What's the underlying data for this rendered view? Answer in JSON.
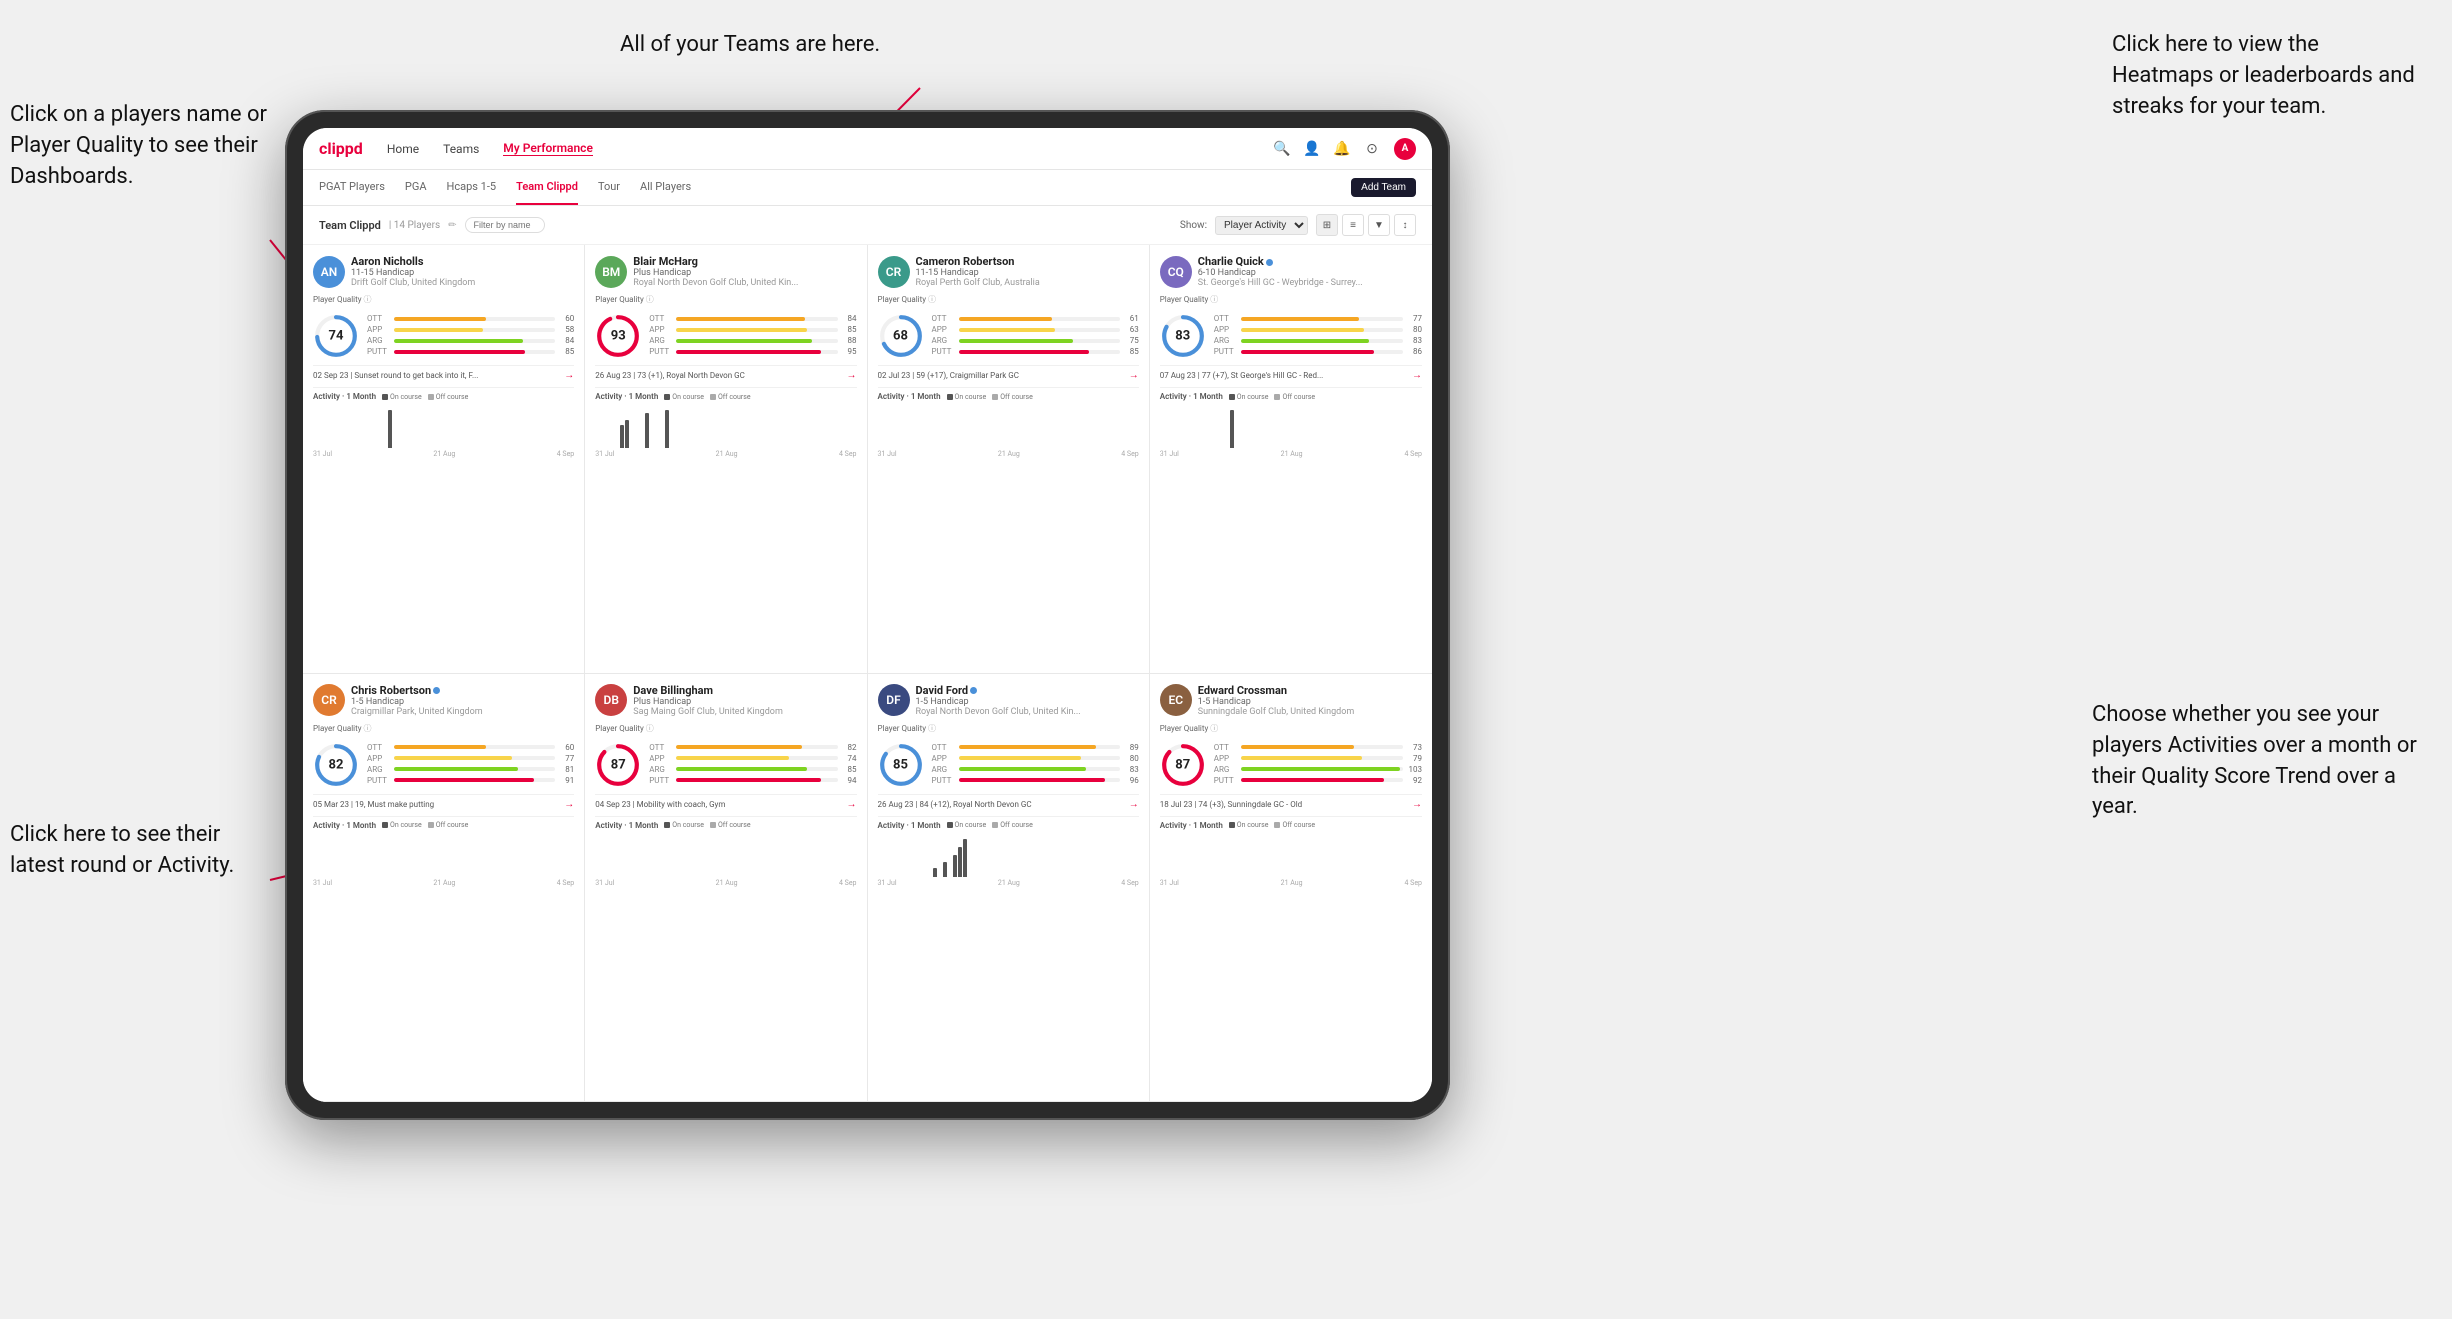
{
  "annotations": {
    "top_left": "Click on a players name\nor Player Quality to see\ntheir Dashboards.",
    "top_center": "All of your Teams are here.",
    "top_right": "Click here to view the\nHeatmaps or leaderboards\nand streaks for your team.",
    "bottom_left": "Click here to see their latest\nround or Activity.",
    "bottom_right": "Choose whether you see\nyour players Activities over\na month or their Quality\nScore Trend over a year."
  },
  "nav": {
    "logo": "clippd",
    "items": [
      "Home",
      "Teams",
      "My Performance"
    ],
    "icons": [
      "search",
      "person",
      "bell",
      "circle-question",
      "avatar"
    ]
  },
  "subnav": {
    "tabs": [
      "PGAT Players",
      "PGA",
      "Hcaps 1-5",
      "Team Clippd",
      "Tour",
      "All Players"
    ],
    "active": "Team Clippd",
    "add_button": "Add Team"
  },
  "team_header": {
    "title": "Team Clippd",
    "count": "14 Players",
    "show_label": "Show:",
    "show_option": "Player Activity",
    "filter_placeholder": "Filter by name"
  },
  "players": [
    {
      "name": "Aaron Nicholls",
      "handicap": "11-15 Handicap",
      "club": "Drift Golf Club, United Kingdom",
      "quality": 74,
      "quality_color": "#4a90d9",
      "stats": [
        {
          "label": "OTT",
          "value": 60,
          "color": "#f5a623"
        },
        {
          "label": "APP",
          "value": 58,
          "color": "#f8d44a"
        },
        {
          "label": "ARG",
          "value": 84,
          "color": "#7ed321"
        },
        {
          "label": "PUTT",
          "value": 85,
          "color": "#e8003d"
        }
      ],
      "latest_round": "02 Sep 23 | Sunset round to get back into it, F...",
      "activity_label": "Activity · 1 Month",
      "chart_bars": [
        0,
        0,
        0,
        0,
        0,
        0,
        0,
        0,
        0,
        0,
        0,
        0,
        0,
        0,
        0,
        14,
        0,
        0,
        0,
        0,
        0,
        0,
        0,
        0,
        0
      ],
      "chart_labels": [
        "31 Jul",
        "21 Aug",
        "4 Sep"
      ],
      "av_color": "av-blue",
      "av_text": "AN"
    },
    {
      "name": "Blair McHarg",
      "handicap": "Plus Handicap",
      "club": "Royal North Devon Golf Club, United Kin...",
      "quality": 93,
      "quality_color": "#e8003d",
      "stats": [
        {
          "label": "OTT",
          "value": 84,
          "color": "#f5a623"
        },
        {
          "label": "APP",
          "value": 85,
          "color": "#f8d44a"
        },
        {
          "label": "ARG",
          "value": 88,
          "color": "#7ed321"
        },
        {
          "label": "PUTT",
          "value": 95,
          "color": "#e8003d"
        }
      ],
      "latest_round": "26 Aug 23 | 73 (+1), Royal North Devon GC",
      "activity_label": "Activity · 1 Month",
      "chart_bars": [
        0,
        0,
        0,
        0,
        0,
        18,
        22,
        0,
        0,
        0,
        28,
        0,
        0,
        0,
        30,
        0,
        0,
        0,
        0,
        0,
        0,
        0,
        0,
        0,
        0
      ],
      "chart_labels": [
        "31 Jul",
        "21 Aug",
        "4 Sep"
      ],
      "av_color": "av-green",
      "av_text": "BM"
    },
    {
      "name": "Cameron Robertson",
      "handicap": "11-15 Handicap",
      "club": "Royal Perth Golf Club, Australia",
      "quality": 68,
      "quality_color": "#4a90d9",
      "stats": [
        {
          "label": "OTT",
          "value": 61,
          "color": "#f5a623"
        },
        {
          "label": "APP",
          "value": 63,
          "color": "#f8d44a"
        },
        {
          "label": "ARG",
          "value": 75,
          "color": "#7ed321"
        },
        {
          "label": "PUTT",
          "value": 85,
          "color": "#e8003d"
        }
      ],
      "latest_round": "02 Jul 23 | 59 (+17), Craigmillar Park GC",
      "activity_label": "Activity · 1 Month",
      "chart_bars": [
        0,
        0,
        0,
        0,
        0,
        0,
        0,
        0,
        0,
        0,
        0,
        0,
        0,
        0,
        0,
        0,
        0,
        0,
        0,
        0,
        0,
        0,
        0,
        0,
        0
      ],
      "chart_labels": [
        "31 Jul",
        "21 Aug",
        "4 Sep"
      ],
      "av_color": "av-teal",
      "av_text": "CR"
    },
    {
      "name": "Charlie Quick",
      "handicap": "6-10 Handicap",
      "club": "St. George's Hill GC - Weybridge - Surrey...",
      "quality": 83,
      "quality_color": "#4a90d9",
      "stats": [
        {
          "label": "OTT",
          "value": 77,
          "color": "#f5a623"
        },
        {
          "label": "APP",
          "value": 80,
          "color": "#f8d44a"
        },
        {
          "label": "ARG",
          "value": 83,
          "color": "#7ed321"
        },
        {
          "label": "PUTT",
          "value": 86,
          "color": "#e8003d"
        }
      ],
      "latest_round": "07 Aug 23 | 77 (+7), St George's Hill GC - Red...",
      "activity_label": "Activity · 1 Month",
      "chart_bars": [
        0,
        0,
        0,
        0,
        0,
        0,
        0,
        0,
        0,
        0,
        0,
        0,
        0,
        0,
        14,
        0,
        0,
        0,
        0,
        0,
        0,
        0,
        0,
        0,
        0
      ],
      "chart_labels": [
        "31 Jul",
        "21 Aug",
        "4 Sep"
      ],
      "av_color": "av-purple",
      "av_text": "CQ",
      "verified": true
    },
    {
      "name": "Chris Robertson",
      "handicap": "1-5 Handicap",
      "club": "Craigmillar Park, United Kingdom",
      "quality": 82,
      "quality_color": "#4a90d9",
      "stats": [
        {
          "label": "OTT",
          "value": 60,
          "color": "#f5a623"
        },
        {
          "label": "APP",
          "value": 77,
          "color": "#f8d44a"
        },
        {
          "label": "ARG",
          "value": 81,
          "color": "#7ed321"
        },
        {
          "label": "PUTT",
          "value": 91,
          "color": "#e8003d"
        }
      ],
      "latest_round": "05 Mar 23 | 19, Must make putting",
      "activity_label": "Activity · 1 Month",
      "chart_bars": [
        0,
        0,
        0,
        0,
        0,
        0,
        0,
        0,
        0,
        0,
        0,
        0,
        0,
        0,
        0,
        0,
        0,
        0,
        0,
        0,
        0,
        0,
        0,
        0,
        0
      ],
      "chart_labels": [
        "31 Jul",
        "21 Aug",
        "4 Sep"
      ],
      "av_color": "av-orange",
      "av_text": "CR",
      "verified": true
    },
    {
      "name": "Dave Billingham",
      "handicap": "Plus Handicap",
      "club": "Sag Maing Golf Club, United Kingdom",
      "quality": 87,
      "quality_color": "#e8003d",
      "stats": [
        {
          "label": "OTT",
          "value": 82,
          "color": "#f5a623"
        },
        {
          "label": "APP",
          "value": 74,
          "color": "#f8d44a"
        },
        {
          "label": "ARG",
          "value": 85,
          "color": "#7ed321"
        },
        {
          "label": "PUTT",
          "value": 94,
          "color": "#e8003d"
        }
      ],
      "latest_round": "04 Sep 23 | Mobility with coach, Gym",
      "activity_label": "Activity · 1 Month",
      "chart_bars": [
        0,
        0,
        0,
        0,
        0,
        0,
        0,
        0,
        0,
        0,
        0,
        0,
        0,
        0,
        0,
        0,
        0,
        0,
        0,
        0,
        0,
        0,
        0,
        0,
        0
      ],
      "chart_labels": [
        "31 Jul",
        "21 Aug",
        "4 Sep"
      ],
      "av_color": "av-red",
      "av_text": "DB"
    },
    {
      "name": "David Ford",
      "handicap": "1-5 Handicap",
      "club": "Royal North Devon Golf Club, United Kin...",
      "quality": 85,
      "quality_color": "#4a90d9",
      "stats": [
        {
          "label": "OTT",
          "value": 89,
          "color": "#f5a623"
        },
        {
          "label": "APP",
          "value": 80,
          "color": "#f8d44a"
        },
        {
          "label": "ARG",
          "value": 83,
          "color": "#7ed321"
        },
        {
          "label": "PUTT",
          "value": 96,
          "color": "#e8003d"
        }
      ],
      "latest_round": "26 Aug 23 | 84 (+12), Royal North Devon GC",
      "activity_label": "Activity · 1 Month",
      "chart_bars": [
        0,
        0,
        0,
        0,
        0,
        0,
        0,
        0,
        0,
        0,
        0,
        8,
        0,
        14,
        0,
        20,
        28,
        35,
        0,
        0,
        0,
        0,
        0,
        0,
        0
      ],
      "chart_labels": [
        "31 Jul",
        "21 Aug",
        "4 Sep"
      ],
      "av_color": "av-navy",
      "av_text": "DF",
      "verified": true
    },
    {
      "name": "Edward Crossman",
      "handicap": "1-5 Handicap",
      "club": "Sunningdale Golf Club, United Kingdom",
      "quality": 87,
      "quality_color": "#e8003d",
      "stats": [
        {
          "label": "OTT",
          "value": 73,
          "color": "#f5a623"
        },
        {
          "label": "APP",
          "value": 79,
          "color": "#f8d44a"
        },
        {
          "label": "ARG",
          "value": 103,
          "color": "#7ed321"
        },
        {
          "label": "PUTT",
          "value": 92,
          "color": "#e8003d"
        }
      ],
      "latest_round": "18 Jul 23 | 74 (+3), Sunningdale GC - Old",
      "activity_label": "Activity · 1 Month",
      "chart_bars": [
        0,
        0,
        0,
        0,
        0,
        0,
        0,
        0,
        0,
        0,
        0,
        0,
        0,
        0,
        0,
        0,
        0,
        0,
        0,
        0,
        0,
        0,
        0,
        0,
        0
      ],
      "chart_labels": [
        "31 Jul",
        "21 Aug",
        "4 Sep"
      ],
      "av_color": "av-brown",
      "av_text": "EC"
    }
  ]
}
